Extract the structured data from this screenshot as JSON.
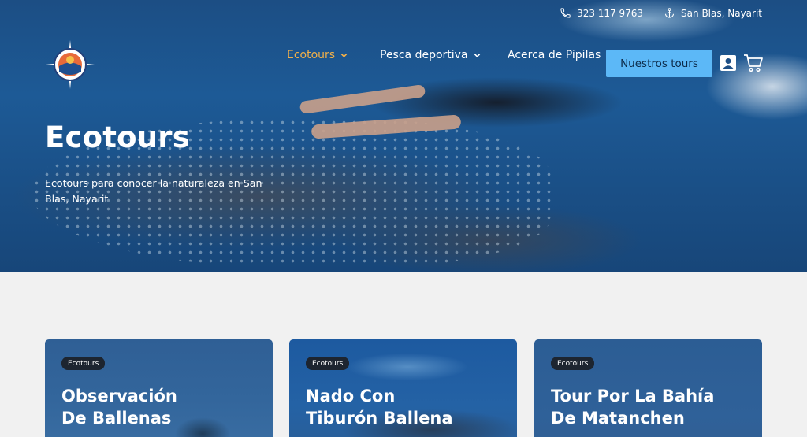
{
  "topbar": {
    "phone": "323 117 9763",
    "location": "San Blas, Nayarit"
  },
  "nav": {
    "items": [
      {
        "label": "Ecotours",
        "active": true,
        "dropdown": true
      },
      {
        "label": "Pesca deportiva",
        "active": false,
        "dropdown": true
      },
      {
        "label": "Acerca de Pipilas",
        "active": false,
        "dropdown": false
      }
    ],
    "cta_label": "Nuestros tours"
  },
  "hero": {
    "title": "Ecotours",
    "subtitle": "Ecotours para conocer la naturaleza en San Blas, Nayarit"
  },
  "cards": [
    {
      "badge": "Ecotours",
      "title_line1": "Observación",
      "title_line2": "De Ballenas"
    },
    {
      "badge": "Ecotours",
      "title_line1": "Nado Con",
      "title_line2": "Tiburón Ballena"
    },
    {
      "badge": "Ecotours",
      "title_line1": "Tour Por La Bahía",
      "title_line2": "De Matanchen"
    }
  ],
  "colors": {
    "active_nav": "#f2b049",
    "cta_bg": "#5cb8f7",
    "badge_bg": "#1d2530",
    "page_bg": "#f1f1f1"
  },
  "icons": [
    "phone-icon",
    "anchor-icon",
    "logo-compass",
    "chevron-down-icon",
    "user-icon",
    "cart-icon"
  ]
}
